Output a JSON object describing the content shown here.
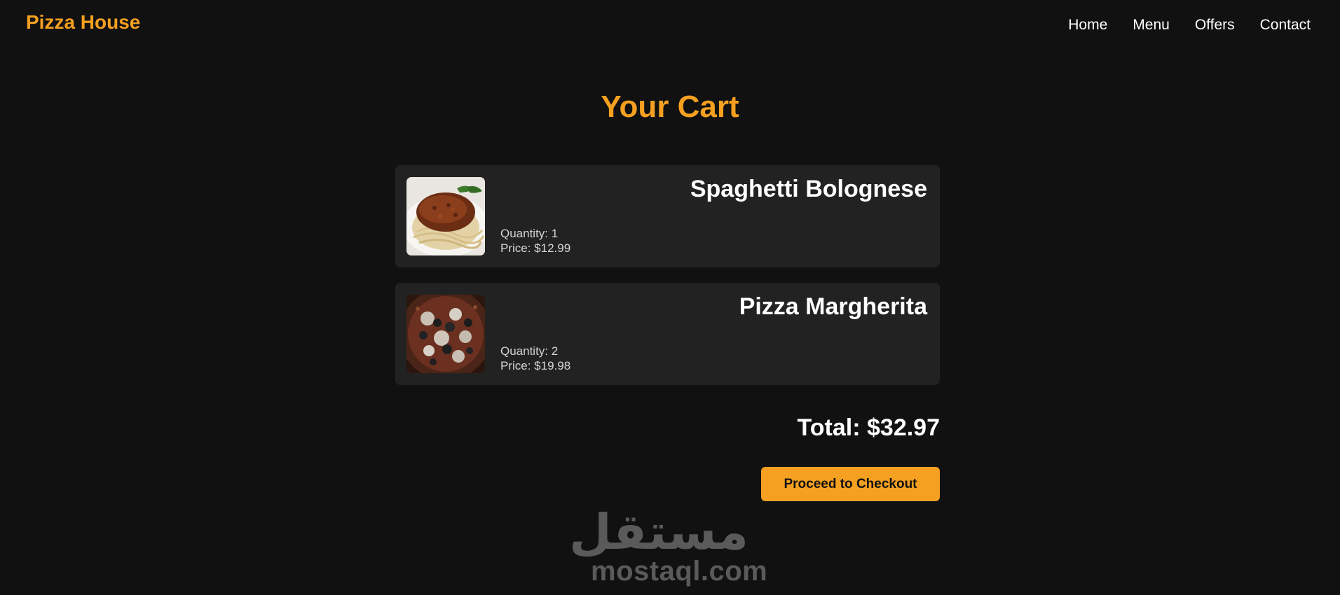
{
  "navbar": {
    "brand": "Pizza House",
    "links": [
      {
        "label": "Home"
      },
      {
        "label": "Menu"
      },
      {
        "label": "Offers"
      },
      {
        "label": "Contact"
      }
    ]
  },
  "cart": {
    "title": "Your Cart",
    "items": [
      {
        "name": "Spaghetti Bolognese",
        "quantity_text": "Quantity: 1",
        "price_text": "Price: $12.99",
        "image": "spaghetti-bolognese-photo"
      },
      {
        "name": "Pizza Margherita",
        "quantity_text": "Quantity: 2",
        "price_text": "Price: $19.98",
        "image": "pizza-photo"
      }
    ],
    "total_text": "Total: $32.97",
    "checkout_label": "Proceed to Checkout"
  },
  "watermark": {
    "arabic": "مستقل",
    "latin": "mostaql.com"
  },
  "colors": {
    "background": "#111111",
    "card": "#222222",
    "accent": "#f5a020",
    "text": "#ffffff",
    "muted_text": "#d6d6d6"
  }
}
